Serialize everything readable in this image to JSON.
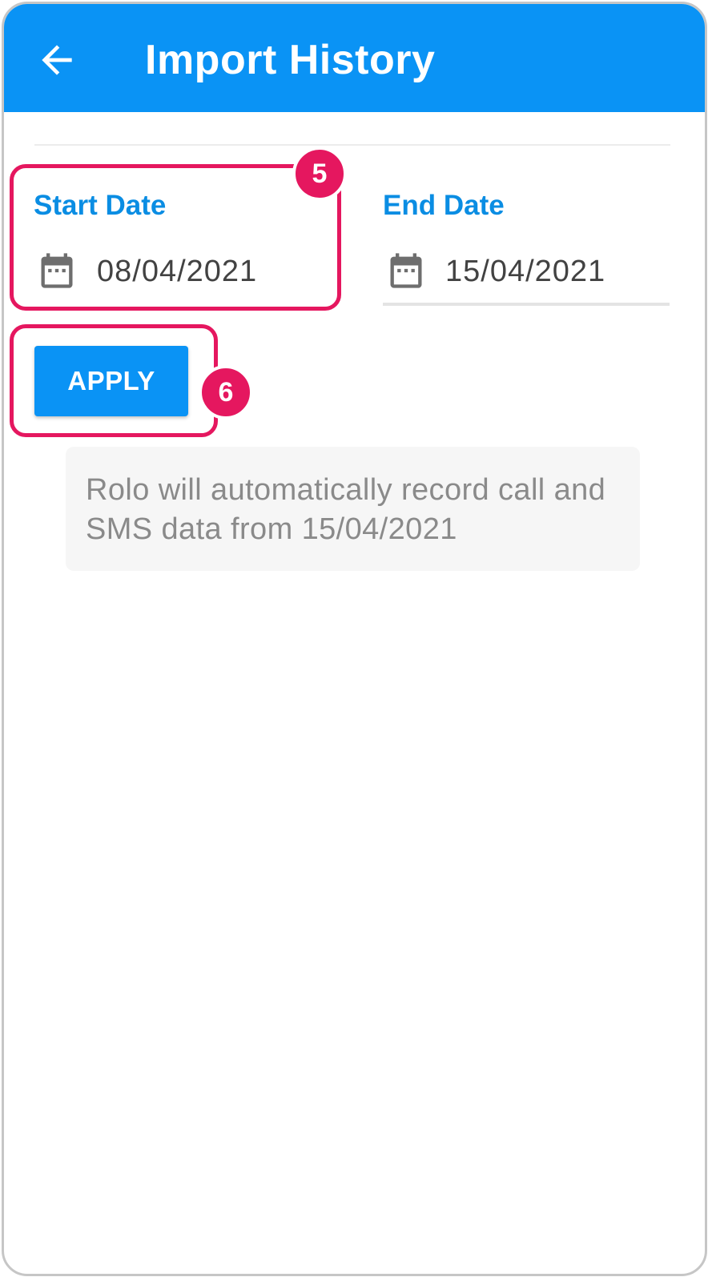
{
  "appbar": {
    "title": "Import History",
    "back_icon": "arrow-left-icon",
    "color": "#0a93f5"
  },
  "start_date": {
    "label": "Start Date",
    "value": "08/04/2021",
    "icon": "calendar-icon"
  },
  "end_date": {
    "label": "End Date",
    "value": "15/04/2021",
    "icon": "calendar-icon"
  },
  "apply_button": {
    "label": "APPLY"
  },
  "info": {
    "text": "Rolo will automatically record call and SMS data from 15/04/2021"
  },
  "annotations": {
    "step_5": "5",
    "step_6": "6",
    "highlight_color": "#e5175f"
  }
}
